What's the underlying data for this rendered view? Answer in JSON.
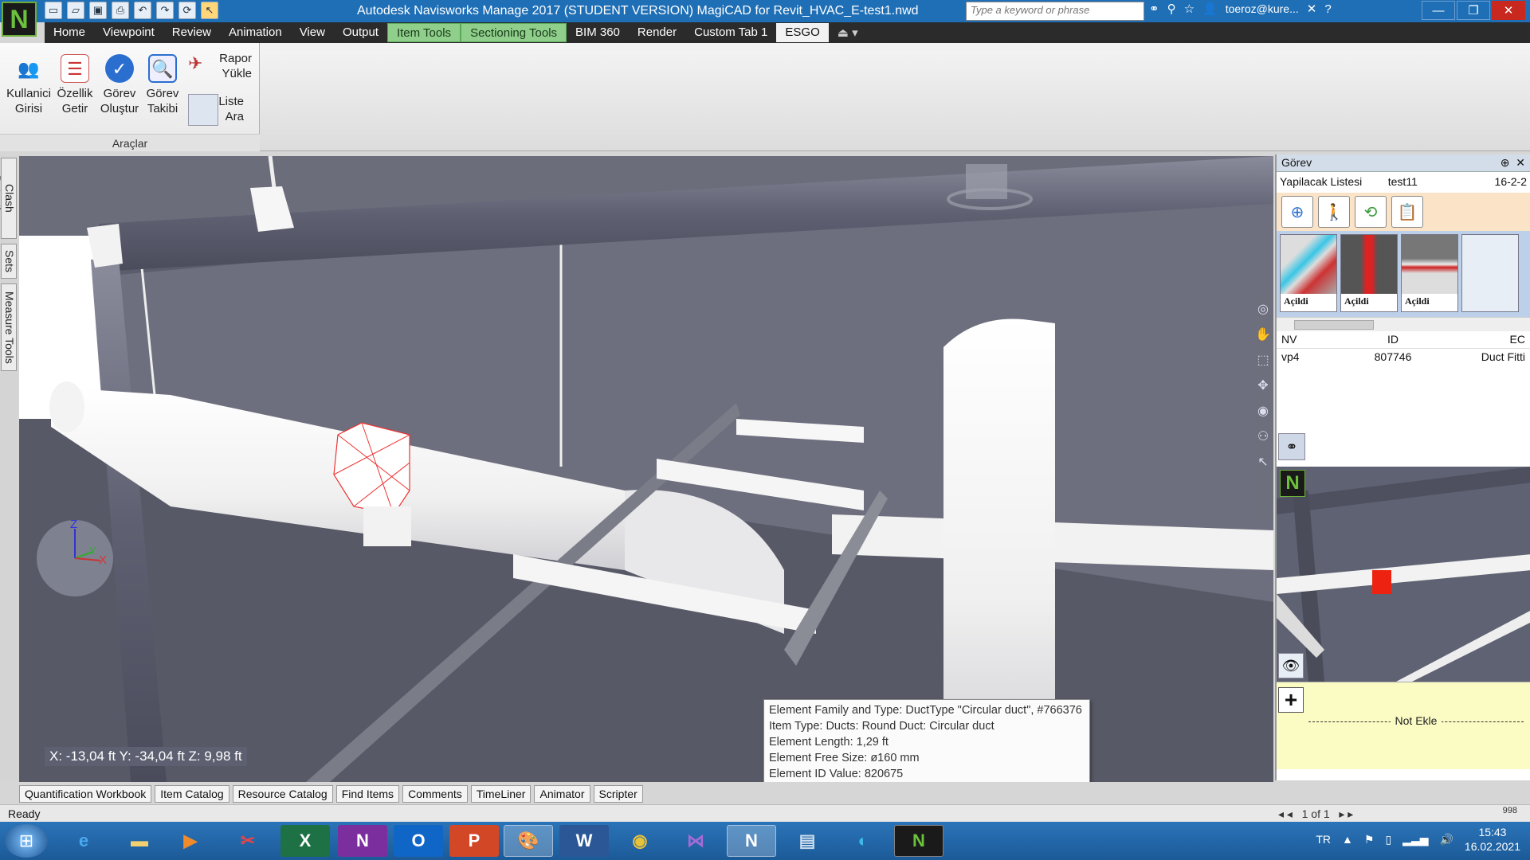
{
  "window": {
    "title": "Autodesk Navisworks Manage 2017 (STUDENT VERSION)    MagiCAD for Revit_HVAC_E-test1.nwd",
    "search_placeholder": "Type a keyword or phrase",
    "user": "toeroz@kure..."
  },
  "menu": [
    "Home",
    "Viewpoint",
    "Review",
    "Animation",
    "View",
    "Output",
    "Item Tools",
    "Sectioning Tools",
    "BIM 360",
    "Render",
    "Custom Tab 1",
    "ESGO"
  ],
  "ribbon": {
    "buttons": [
      {
        "line1": "Kullanici",
        "line2": "Girisi"
      },
      {
        "line1": "Özellik",
        "line2": "Getir"
      },
      {
        "line1": "Görev",
        "line2": "Oluştur"
      },
      {
        "line1": "Görev",
        "line2": "Takibi"
      }
    ],
    "small_buttons": [
      {
        "line1": "Rapor",
        "line2": "Yükle"
      },
      {
        "line1": "Liste",
        "line2": "Ara"
      }
    ],
    "group_label": "Araçlar"
  },
  "left_dock": [
    "Clash Detective",
    "Sets",
    "Measure Tools"
  ],
  "viewport": {
    "axis_labels": {
      "z": "Z",
      "y": "Y",
      "x": "X"
    },
    "coords": "X: -13,04 ft  Y: -34,04 ft  Z: 9,98 ft",
    "tooltip": [
      "Element Family and Type: DuctType \"Circular duct\", #766376",
      "Item Type: Ducts: Round Duct: Circular duct",
      "Element Length: 1,29 ft",
      "Element Free Size: ø160 mm",
      "Element ID Value: 820675"
    ]
  },
  "panel": {
    "title": "Görev",
    "todo_label": "Yapilacak Listesi",
    "todo_name": "test11",
    "todo_date": "16-2-2",
    "thumbs": [
      "Açildi",
      "Açildi",
      "Açildi"
    ],
    "grid_headers": [
      "NV",
      "ID",
      "EC"
    ],
    "grid_row": [
      "vp4",
      "807746",
      "Duct Fitti"
    ],
    "note_label": "Not Ekle"
  },
  "bottom_tabs": [
    "Quantification Workbook",
    "Item Catalog",
    "Resource Catalog",
    "Find Items",
    "Comments",
    "TimeLiner",
    "Animator",
    "Scripter"
  ],
  "status": {
    "text": "Ready",
    "page": "1 of 1",
    "memory": "998"
  },
  "taskbar": {
    "lang": "TR",
    "time": "15:43",
    "date": "16.02.2021"
  }
}
